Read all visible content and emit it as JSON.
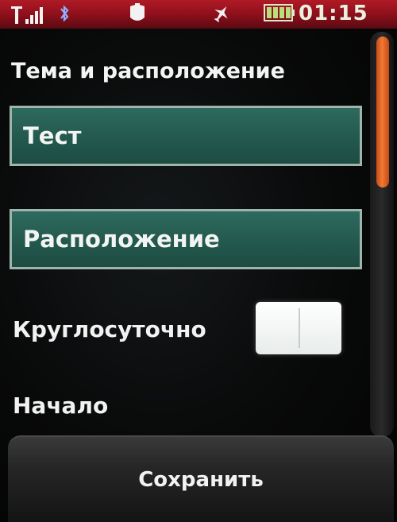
{
  "status_bar": {
    "time": "01:15",
    "icons": [
      "signal-icon",
      "bluetooth-icon",
      "app-notification-icon",
      "airplane-icon",
      "battery-icon"
    ],
    "colors": {
      "background": "#9a1420",
      "text": "#e8f0e0"
    }
  },
  "form": {
    "section_title": "Тема и расположение",
    "subject_field": {
      "value": "Тест"
    },
    "location_field": {
      "value": "Расположение"
    },
    "all_day_label": "Круглосуточно",
    "start_label": "Начало"
  },
  "softkeys": {
    "save_label": "Сохранить"
  },
  "colors": {
    "field_fill": "#245a4f",
    "field_border": "#9fb5ac",
    "scroll_thumb": "#e8662a"
  }
}
